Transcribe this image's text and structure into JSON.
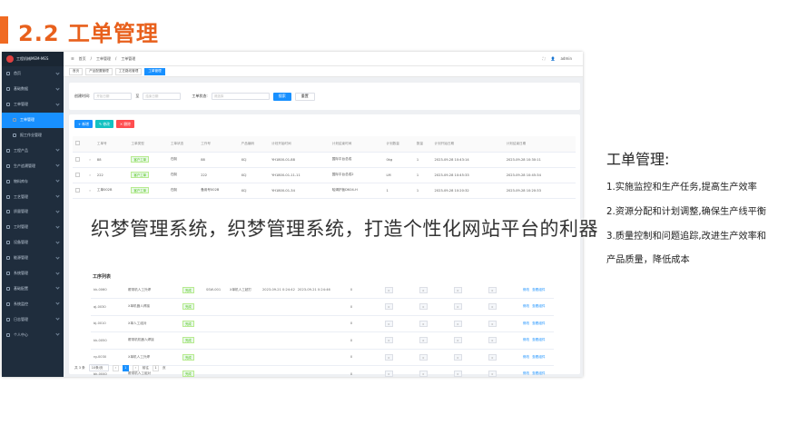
{
  "heading": "2.2 工单管理",
  "sidebar": {
    "logo": "工程机械MEM-MES",
    "items": [
      {
        "label": "首页"
      },
      {
        "label": "基础数据"
      },
      {
        "label": "工单管理"
      },
      {
        "label": "工单管理",
        "sub": true,
        "active": true
      },
      {
        "label": "报工作业管理",
        "sub": true
      },
      {
        "label": "工程产品"
      },
      {
        "label": "生产追溯管理"
      },
      {
        "label": "物料库存"
      },
      {
        "label": "工艺管理"
      },
      {
        "label": "质量管理"
      },
      {
        "label": "工时管理"
      },
      {
        "label": "设备管理"
      },
      {
        "label": "能源管理"
      },
      {
        "label": "系统管理"
      },
      {
        "label": "基础配置"
      },
      {
        "label": "系统监控"
      },
      {
        "label": "日志管理"
      },
      {
        "label": "个人中心"
      }
    ]
  },
  "topbar": {
    "breadcrumb": [
      "首页",
      "工单管理",
      "工单管理"
    ],
    "user": "admin"
  },
  "tabs": [
    "首页",
    "产品配置管理",
    "工艺路线管理",
    "工单管理"
  ],
  "filter": {
    "label1": "创建时间:",
    "start_placeholder": "开始日期",
    "to": "至",
    "end_placeholder": "结束日期",
    "label2": "工单状态:",
    "status_placeholder": "请选择",
    "search": "搜索",
    "reset": "重置"
  },
  "actions": [
    {
      "label": "+ 新增",
      "color": "#1890ff"
    },
    {
      "label": "✎ 修改",
      "color": "#13c2c2"
    },
    {
      "label": "✕ 删除",
      "color": "#ff4d4f"
    }
  ],
  "table": {
    "headers": [
      "",
      "",
      "工单号",
      "工单类型",
      "工单状态",
      "工作号",
      "产品编码",
      "计划开始时间",
      "计划结束时间",
      "计划数量",
      "数量",
      "计划开始日期",
      "计划结束日期"
    ],
    "rows": [
      [
        "88",
        "客户工单",
        "在制",
        "88",
        "XCJ",
        "YH1800-01-88",
        "国际平台总成",
        "0kg",
        "1",
        "2023-09-28 10:43:14",
        "2023-09-28 10:30:11"
      ],
      [
        "222",
        "客户工单",
        "在制",
        "222",
        "XCJ",
        "YH1800-01-11-11",
        "国际平台总成2",
        "LM",
        "1",
        "2023-09-28 10:45:33",
        "2023-09-28 10:45:34"
      ],
      [
        "工单002B",
        "客户工单",
        "在制",
        "备用号002B",
        "XCJ",
        "YH1800-01-34",
        "哈姆护板DK04-H",
        "1",
        "1",
        "2023-09-28 10:20:32",
        "2023-09-28 10:20:33"
      ]
    ]
  },
  "subtable": {
    "title": "工序列表",
    "rows": [
      {
        "code": "kk-0060",
        "name": "覆带机人工外焊",
        "tag": "完成",
        "a": "SSW-001",
        "b": "X单机人工超打",
        "t1": "2023-09-21 0:24:42",
        "t2": "2023-09-21 0:24:46",
        "n": "0"
      },
      {
        "code": "qj-0030",
        "name": "X单机器人焊接",
        "tag": "完成",
        "a": "",
        "b": "",
        "t1": "",
        "t2": "",
        "n": "0"
      },
      {
        "code": "bj-0010",
        "name": "X单人工组对",
        "tag": "完成",
        "a": "",
        "b": "",
        "t1": "",
        "t2": "",
        "n": "0"
      },
      {
        "code": "kk-0050",
        "name": "覆带机机器人焊接",
        "tag": "完成",
        "a": "",
        "b": "",
        "t1": "",
        "t2": "",
        "n": "0"
      },
      {
        "code": "rg-0030",
        "name": "X单机人工外焊",
        "tag": "完成",
        "a": "",
        "b": "",
        "t1": "",
        "t2": "",
        "n": "0"
      },
      {
        "code": "bk-0040",
        "name": "覆带机人工组对",
        "tag": "完成",
        "a": "",
        "b": "",
        "t1": "",
        "t2": "",
        "n": "0"
      }
    ],
    "links": [
      "修改",
      "查看组件"
    ]
  },
  "pager": {
    "total": "共 3 条",
    "size": "10条/页",
    "page": "1",
    "goto": "前往",
    "goto_page": "1",
    "unit": "页"
  },
  "notes": {
    "title": "工单管理:",
    "lines": [
      "1.实施监控和生产任务,提高生产效率",
      "2.资源分配和计划调整,确保生产线平衡",
      "3.质量控制和问题追踪,改进生产效率和",
      "产品质量，降低成本"
    ]
  },
  "overlay": "织梦管理系统，织梦管理系统，打造个性化网站平台的利器"
}
